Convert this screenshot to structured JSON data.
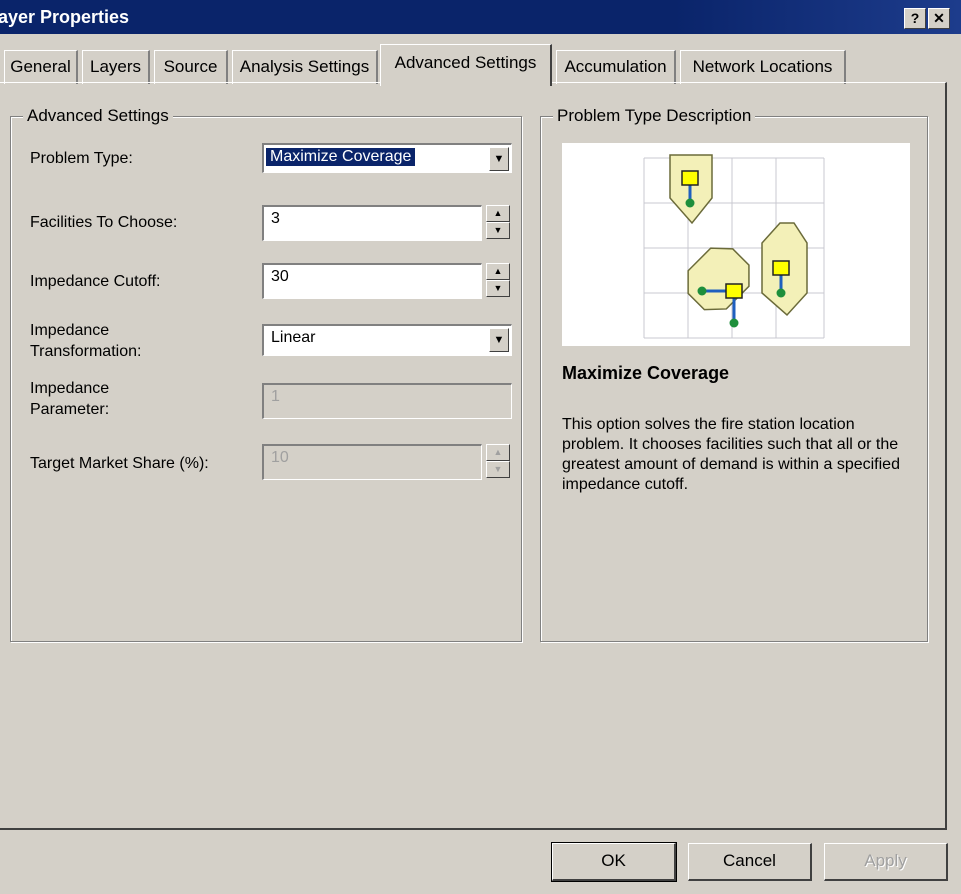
{
  "window": {
    "title": "ayer Properties",
    "help_label": "?",
    "close_label": "✕"
  },
  "tabs": [
    {
      "label": "General"
    },
    {
      "label": "Layers"
    },
    {
      "label": "Source"
    },
    {
      "label": "Analysis Settings"
    },
    {
      "label": "Advanced Settings",
      "active": true
    },
    {
      "label": "Accumulation"
    },
    {
      "label": "Network Locations"
    }
  ],
  "advanced": {
    "group_title": "Advanced Settings",
    "problem_type": {
      "label": "Problem Type:",
      "value": "Maximize Coverage"
    },
    "facilities": {
      "label": "Facilities To Choose:",
      "value": "3"
    },
    "cutoff": {
      "label": "Impedance Cutoff:",
      "value": "30"
    },
    "transformation": {
      "label_line1": "Impedance",
      "label_line2": "Transformation:",
      "value": "Linear"
    },
    "parameter": {
      "label_line1": "Impedance",
      "label_line2": "Parameter:",
      "value": "1"
    },
    "market_share": {
      "label": "Target Market Share (%):",
      "value": "10"
    }
  },
  "description": {
    "group_title": "Problem Type Description",
    "title": "Maximize Coverage",
    "text": "This option solves the fire station location problem. It chooses facilities such that all or the greatest amount of demand is within a specified impedance cutoff."
  },
  "buttons": {
    "ok": "OK",
    "cancel": "Cancel",
    "apply": "Apply"
  },
  "colors": {
    "titlebar": "#0a246a",
    "face": "#d4d0c8",
    "highlight": "#0a246a",
    "facility": "#ffff00",
    "demand": "#1e8f3c",
    "coverage": "#f3f0b8"
  }
}
